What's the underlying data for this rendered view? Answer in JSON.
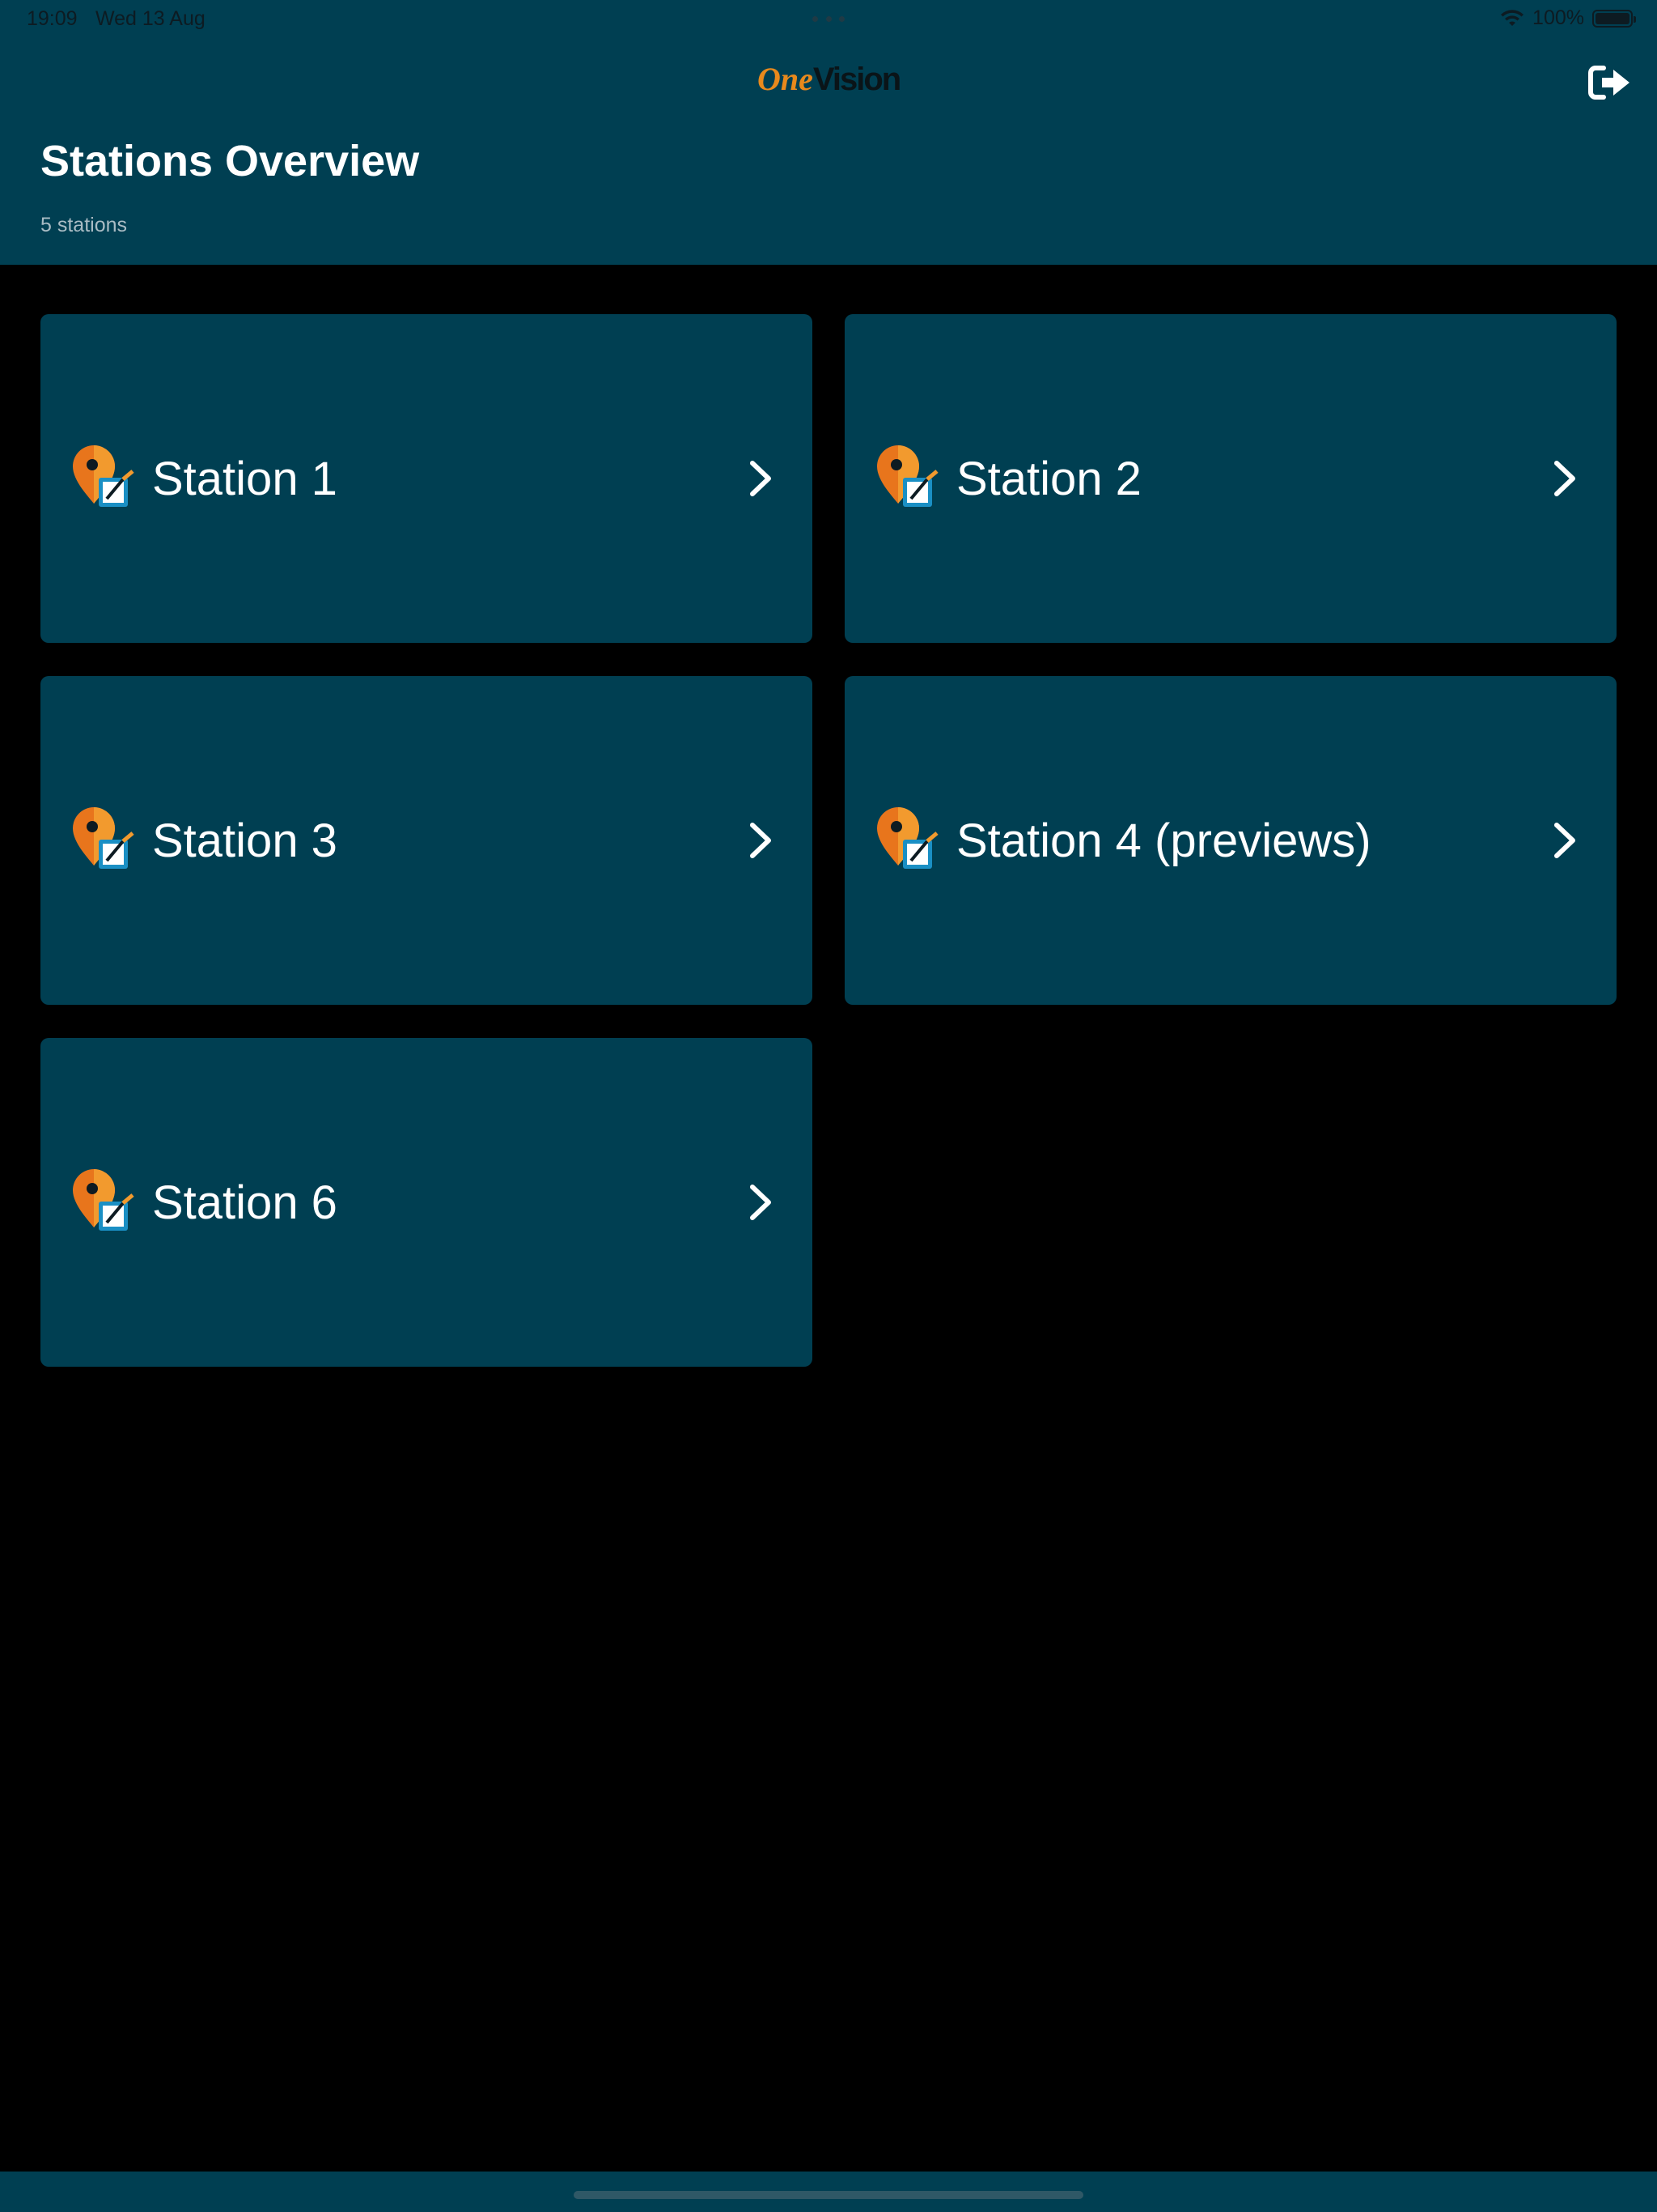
{
  "status_bar": {
    "time": "19:09",
    "date": "Wed 13 Aug",
    "battery_percent": "100%",
    "battery_level": 1.0
  },
  "header": {
    "logo_part1": "One",
    "logo_part2": "Vision",
    "title": "Stations Overview",
    "subtitle": "5 stations",
    "logout_icon": "sign-out-icon"
  },
  "stations": [
    {
      "label": "Station 1",
      "icon": "map-pin-edit-icon"
    },
    {
      "label": "Station 2",
      "icon": "map-pin-edit-icon"
    },
    {
      "label": "Station 3",
      "icon": "map-pin-edit-icon"
    },
    {
      "label": "Station 4 (previews)",
      "icon": "map-pin-edit-icon"
    },
    {
      "label": "Station 6",
      "icon": "map-pin-edit-icon"
    }
  ],
  "colors": {
    "header_bg": "#003f52",
    "card_bg": "#003f52",
    "page_bg": "#000000",
    "accent": "#e8891c"
  }
}
